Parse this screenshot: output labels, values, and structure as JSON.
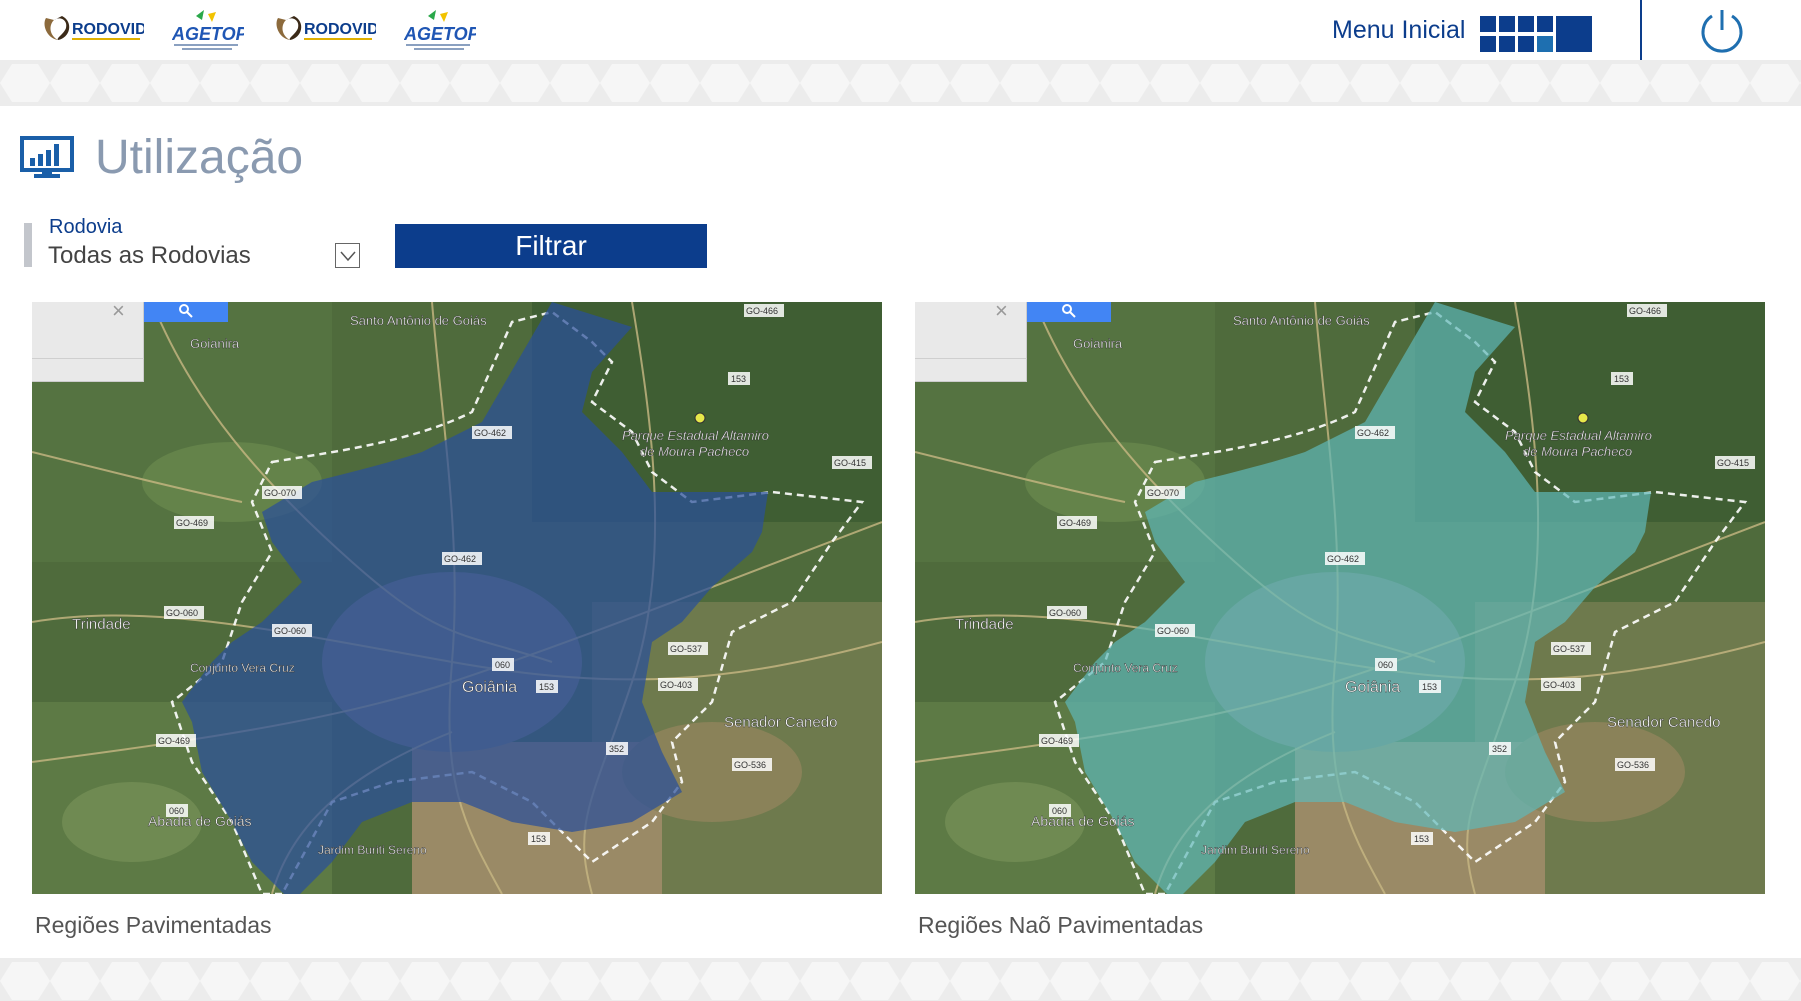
{
  "header": {
    "logos": [
      {
        "name": "rodovida-logo",
        "text": "RODOVIDA"
      },
      {
        "name": "agetop-logo",
        "text": "AGETOP"
      },
      {
        "name": "rodovida-logo",
        "text": "RODOVIDA"
      },
      {
        "name": "agetop-logo",
        "text": "AGETOP"
      }
    ],
    "menu_label": "Menu Inicial",
    "menu_icon": "grid-tiles-icon",
    "power_icon": "power-icon",
    "brand_color": "#0c3d8c"
  },
  "page": {
    "title": "Utilização",
    "title_icon": "monitor-chart-icon"
  },
  "filter": {
    "label": "Rodovia",
    "selected": "Todas as Rodovias",
    "button_label": "Filtrar"
  },
  "maps": [
    {
      "caption": "Regiões Pavimentadas",
      "overlay_color": "#2a4f9a",
      "labels": {
        "goianira": "Goianira",
        "santo_antonio": "Santo Antônio de Goiás",
        "parque1": "Parque Estadual Altamiro",
        "parque2": "de Moura Pacheco",
        "trindade": "Trindade",
        "vera_cruz": "Conjunto Vera Cruz",
        "goiania": "Goiânia",
        "senador": "Senador Canedo",
        "abadia": "Abadia de Goiás",
        "jardim": "Jardim Buriti Sereno",
        "go466": "GO-466",
        "r153a": "153",
        "go462a": "GO-462",
        "go415": "GO-415",
        "go070": "GO-070",
        "go469": "GO-469",
        "go462b": "GO-462",
        "go060a": "GO-060",
        "go060b": "GO-060",
        "r060": "060",
        "r153b": "153",
        "go537": "GO-537",
        "go403": "GO-403",
        "go469b": "GO-469",
        "r352": "352",
        "go536": "GO-536",
        "r060b": "060",
        "r153c": "153"
      }
    },
    {
      "caption": "Regiões Naõ Pavimentadas",
      "overlay_color": "#5fb8b8",
      "labels": {
        "goianira": "Goianira",
        "santo_antonio": "Santo Antônio de Goiás",
        "parque1": "Parque Estadual Altamiro",
        "parque2": "de Moura Pacheco",
        "trindade": "Trindade",
        "vera_cruz": "Conjunto Vera Cruz",
        "goiania": "Goiânia",
        "senador": "Senador Canedo",
        "abadia": "Abadia de Goiás",
        "jardim": "Jardim Buriti Sereno",
        "go466": "GO-466",
        "r153a": "153",
        "go462a": "GO-462",
        "go415": "GO-415",
        "go070": "GO-070",
        "go469": "GO-469",
        "go462b": "GO-462",
        "go060a": "GO-060",
        "go060b": "GO-060",
        "r060": "060",
        "r153b": "153",
        "go537": "GO-537",
        "go403": "GO-403",
        "go469b": "GO-469",
        "r352": "352",
        "go536": "GO-536",
        "r060b": "060",
        "r153c": "153"
      }
    }
  ]
}
